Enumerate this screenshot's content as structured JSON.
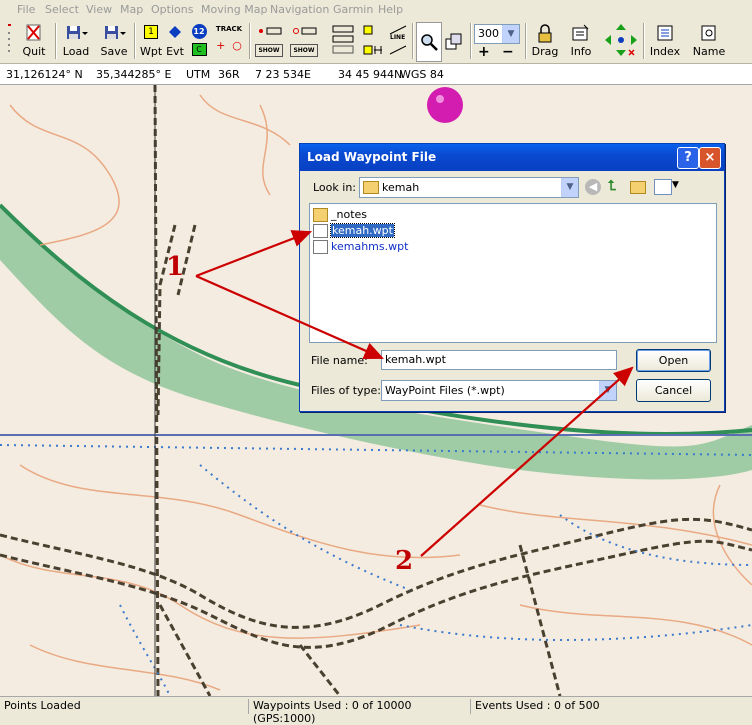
{
  "menu": [
    "File",
    "Select",
    "View",
    "Map",
    "Options",
    "Moving Map",
    "Navigation",
    "Garmin",
    "Help"
  ],
  "toolbar": {
    "quit": "Quit",
    "load": "Load",
    "save": "Save",
    "wpt": "Wpt",
    "evt": "Evt",
    "track": "TRACK",
    "show": "SHOW",
    "line": "LINE",
    "zoom_value": "300",
    "drag": "Drag",
    "info": "Info",
    "index": "Index",
    "name": "Name",
    "badge_1": "1",
    "badge_12": "12",
    "badge_c": "C"
  },
  "coords": {
    "lat": "31,126124° N",
    "lon": "35,344285° E",
    "utm_label": "UTM",
    "zone": "36R",
    "easting": "7 23 534E",
    "northing": "34 45 944N",
    "datum": "WGS 84"
  },
  "dialog": {
    "title": "Load Waypoint File",
    "look_in_label": "Look in:",
    "look_in_value": "kemah",
    "files": [
      {
        "name": "_notes",
        "type": "folder"
      },
      {
        "name": "kemah.wpt",
        "type": "file",
        "selected": true
      },
      {
        "name": "kemahms.wpt",
        "type": "file"
      }
    ],
    "file_name_label": "File name:",
    "file_name_value": "kemah.wpt",
    "files_of_type_label": "Files of type:",
    "files_of_type_value": "WayPoint Files (*.wpt)",
    "open_label": "Open",
    "cancel_label": "Cancel",
    "help_glyph": "?",
    "close_glyph": "×"
  },
  "annotations": {
    "one": "1",
    "two": "2"
  },
  "status": {
    "left": "Points Loaded",
    "waypoints": "Waypoints Used : 0 of 10000  (GPS:1000)",
    "events": "Events Used : 0 of 500"
  },
  "colors": {
    "arrow": "#cc0000",
    "title_bar": "#0a4ad0",
    "selection": "#316ac5"
  }
}
